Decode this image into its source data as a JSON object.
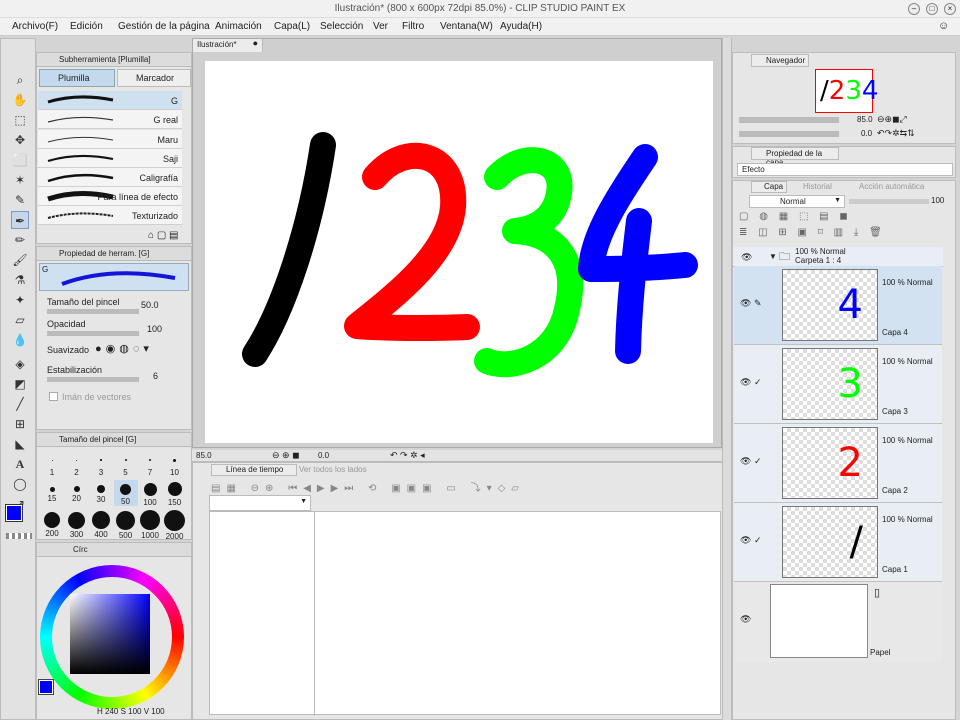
{
  "window": {
    "title": "Ilustración* (800 x 600px 72dpi 85.0%) - CLIP STUDIO PAINT EX"
  },
  "menu": [
    "Archivo(F)",
    "Edición",
    "Gestión de la página",
    "Animación",
    "Capa(L)",
    "Selección",
    "Ver",
    "Filtro",
    "Ventana(W)",
    "Ayuda(H)"
  ],
  "subtool": {
    "header": "Subherramienta [Plumilla]",
    "tabs": [
      "Plumilla",
      "Marcador"
    ],
    "brushes": [
      "G",
      "G real",
      "Maru",
      "Saji",
      "Caligrafía",
      "Para línea de efecto",
      "Texturizado"
    ]
  },
  "toolprop": {
    "header": "Propiedad de herram. [G]",
    "preview_label": "G",
    "size_label": "Tamaño del pincel",
    "size_value": "50.0",
    "opacity_label": "Opacidad",
    "opacity_value": "100",
    "smooth_label": "Suavizado",
    "stab_label": "Estabilización",
    "stab_value": "6",
    "vector_label": "Imán de vectores"
  },
  "brushsize": {
    "header": "Tamaño del pincel [G]",
    "sizes": [
      "1",
      "2",
      "3",
      "5",
      "7",
      "10",
      "15",
      "20",
      "30",
      "50",
      "100",
      "150",
      "200",
      "300",
      "400",
      "500",
      "1000",
      "2000"
    ]
  },
  "color": {
    "header": "Círc",
    "h": "240",
    "s": "100",
    "v": "100",
    "main_color": "#0000ff"
  },
  "document": {
    "tab": "Ilustración*",
    "zoom": "85.0",
    "rotation": "0.0",
    "digits": [
      "/",
      "2",
      "3",
      "4"
    ],
    "colors": {
      "one": "#000000",
      "two": "#ff0000",
      "three": "#00ff00",
      "four": "#0000ff"
    }
  },
  "timeline": {
    "tab": "Línea de tiempo",
    "tab2": "Ver todos los lados"
  },
  "navigator": {
    "tab": "Navegador",
    "zoom": "85.0",
    "rotation": "0.0",
    "preview_digits": [
      "/",
      "2",
      "3",
      "4"
    ]
  },
  "layerprop": {
    "tab": "Propiedad de la capa",
    "effect_label": "Efecto"
  },
  "layers": {
    "tabs": [
      "Capa",
      "Historial",
      "Acción automática"
    ],
    "blend_mode": "Normal",
    "opacity": "100",
    "folder": {
      "pct": "100 % Normal",
      "name": "Carpeta 1 : 4"
    },
    "items": [
      {
        "pct": "100 % Normal",
        "name": "Capa 4",
        "digit": "4",
        "color": "#0000ff"
      },
      {
        "pct": "100 % Normal",
        "name": "Capa 3",
        "digit": "3",
        "color": "#00ff00"
      },
      {
        "pct": "100 % Normal",
        "name": "Capa 2",
        "digit": "2",
        "color": "#ff0000"
      },
      {
        "pct": "100 % Normal",
        "name": "Capa 1",
        "digit": "/",
        "color": "#000000"
      }
    ],
    "paper": {
      "name": "Papel"
    }
  }
}
